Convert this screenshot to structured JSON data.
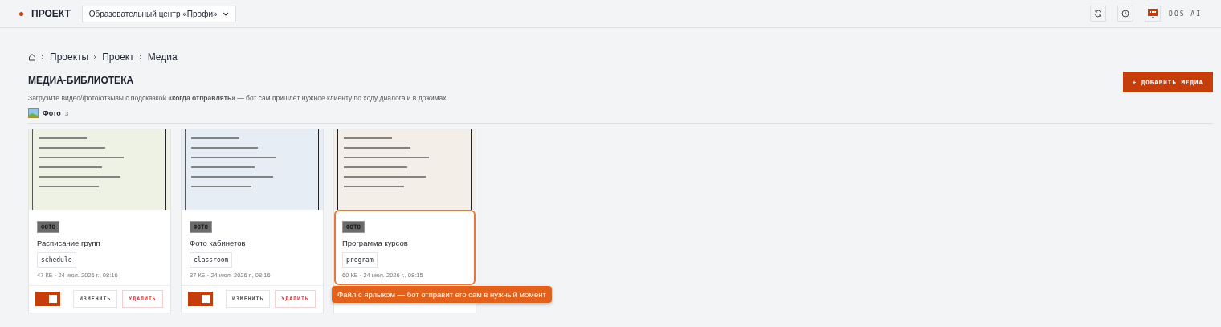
{
  "header": {
    "brand": "ПРОЕКТ",
    "project_select": "Образовательный центр «Профи»",
    "user": "DOS AI"
  },
  "breadcrumbs": [
    "Проекты",
    "Проект",
    "Медиа"
  ],
  "page": {
    "title": "МЕДИА-БИБЛИОТЕКА",
    "subtitle": "Загрузите видео/фото/отзывы с подсказкой **«когда отправлять»** — бот сам пришлёт нужное клиенту по ходу диалога и в дожимах.",
    "add_button": "+ ДОБАВИТЬ МЕДИА"
  },
  "section": {
    "label": "Фото",
    "count": "3"
  },
  "cards": [
    {
      "type_badge": "ФОТО",
      "title": "Расписание групп",
      "tag": "schedule",
      "meta": "47 КБ · 24 июл. 2026 г., 08:16",
      "color": "#edf2e4",
      "highlighted": false,
      "footer": {
        "on": true,
        "edit": "ИЗМЕНИТЬ",
        "delete": "УДАЛИТЬ"
      }
    },
    {
      "type_badge": "ФОТО",
      "title": "Фото кабинетов",
      "tag": "classroom",
      "meta": "37 КБ · 24 июл. 2026 г., 08:16",
      "color": "#e6edf5",
      "highlighted": false,
      "footer": {
        "on": true,
        "edit": "ИЗМЕНИТЬ",
        "delete": "УДАЛИТЬ"
      }
    },
    {
      "type_badge": "ФОТО",
      "title": "Программа курсов",
      "tag": "program",
      "meta": "60 КБ · 24 июл. 2026 г., 08:15",
      "color": "#f3efe8",
      "highlighted": true
    }
  ],
  "tooltip": "Файл с ярлыком — бот отправит его сам в нужный момент"
}
